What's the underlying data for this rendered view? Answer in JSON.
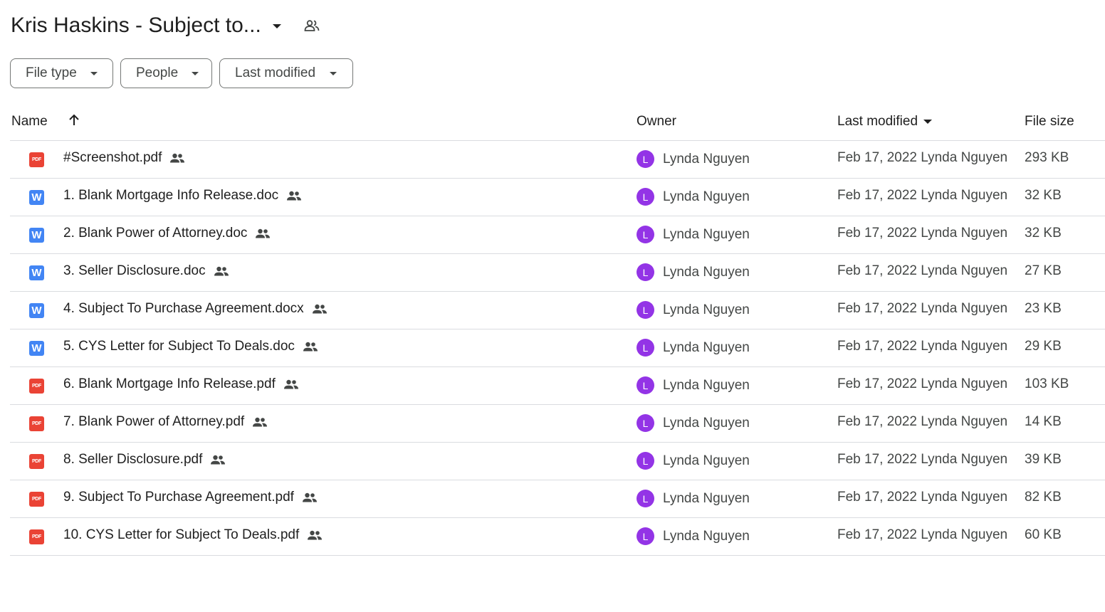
{
  "header": {
    "folder_title": "Kris Haskins - Subject to...",
    "title_dropdown_icon": "caret-down-icon",
    "shared_icon": "shared-folder-icon"
  },
  "filters": {
    "file_type": "File type",
    "people": "People",
    "last_modified": "Last modified"
  },
  "columns": {
    "name": "Name",
    "owner": "Owner",
    "last_modified": "Last modified",
    "file_size": "File size",
    "sort_icon": "arrow-up-icon"
  },
  "files": [
    {
      "name": "#Screenshot.pdf",
      "type": "pdf",
      "owner_initial": "L",
      "owner": "Lynda Nguyen",
      "modified": "Feb 17, 2022 Lynda Nguyen",
      "size": "293 KB"
    },
    {
      "name": "1. Blank Mortgage Info Release.doc",
      "type": "word",
      "owner_initial": "L",
      "owner": "Lynda Nguyen",
      "modified": "Feb 17, 2022 Lynda Nguyen",
      "size": "32 KB"
    },
    {
      "name": "2. Blank Power of Attorney.doc",
      "type": "word",
      "owner_initial": "L",
      "owner": "Lynda Nguyen",
      "modified": "Feb 17, 2022 Lynda Nguyen",
      "size": "32 KB"
    },
    {
      "name": "3. Seller Disclosure.doc",
      "type": "word",
      "owner_initial": "L",
      "owner": "Lynda Nguyen",
      "modified": "Feb 17, 2022 Lynda Nguyen",
      "size": "27 KB"
    },
    {
      "name": "4. Subject To Purchase Agreement.docx",
      "type": "word",
      "owner_initial": "L",
      "owner": "Lynda Nguyen",
      "modified": "Feb 17, 2022 Lynda Nguyen",
      "size": "23 KB"
    },
    {
      "name": "5. CYS Letter for Subject To Deals.doc",
      "type": "word",
      "owner_initial": "L",
      "owner": "Lynda Nguyen",
      "modified": "Feb 17, 2022 Lynda Nguyen",
      "size": "29 KB"
    },
    {
      "name": "6. Blank Mortgage Info Release.pdf",
      "type": "pdf",
      "owner_initial": "L",
      "owner": "Lynda Nguyen",
      "modified": "Feb 17, 2022 Lynda Nguyen",
      "size": "103 KB"
    },
    {
      "name": "7. Blank Power of Attorney.pdf",
      "type": "pdf",
      "owner_initial": "L",
      "owner": "Lynda Nguyen",
      "modified": "Feb 17, 2022 Lynda Nguyen",
      "size": "14 KB"
    },
    {
      "name": "8. Seller Disclosure.pdf",
      "type": "pdf",
      "owner_initial": "L",
      "owner": "Lynda Nguyen",
      "modified": "Feb 17, 2022 Lynda Nguyen",
      "size": "39 KB"
    },
    {
      "name": "9. Subject To Purchase Agreement.pdf",
      "type": "pdf",
      "owner_initial": "L",
      "owner": "Lynda Nguyen",
      "modified": "Feb 17, 2022 Lynda Nguyen",
      "size": "82 KB"
    },
    {
      "name": "10. CYS Letter for Subject To Deals.pdf",
      "type": "pdf",
      "owner_initial": "L",
      "owner": "Lynda Nguyen",
      "modified": "Feb 17, 2022 Lynda Nguyen",
      "size": "60 KB"
    }
  ],
  "icons": {
    "pdf_label": "PDF",
    "word_label": "W",
    "row_shared_icon": "shared-people-icon"
  },
  "colors": {
    "pdf": "#ea4335",
    "word": "#4285f4",
    "avatar": "#9334e6",
    "divider": "#dadce0"
  }
}
